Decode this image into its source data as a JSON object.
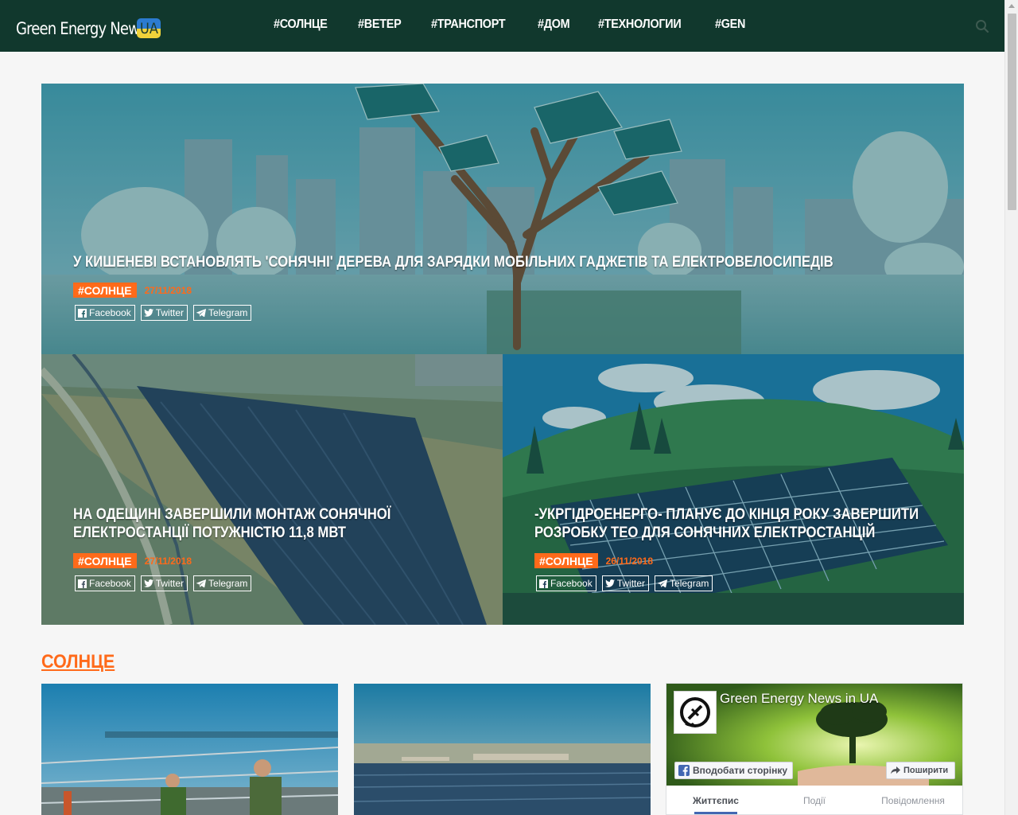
{
  "header": {
    "logo_text": "Green Energy News",
    "logo_badge": "UA",
    "nav": [
      "#СОЛНЦЕ",
      "#ВЕТЕР",
      "#ТРАНСПОРТ",
      "#ДОМ",
      "#ТЕХНОЛОГИИ",
      "#GEN"
    ]
  },
  "featured": [
    {
      "title_lines": [
        "У КИШЕНЕВІ ВСТАНОВЛЯТЬ 'СОНЯЧНІ' ДЕРЕВА ДЛЯ ЗАРЯДКИ МОБІЛЬНИХ ГАДЖЕТІВ ТА ЕЛЕКТРОВЕЛОСИПЕДІВ"
      ],
      "category": "#СОЛНЦЕ",
      "date": "27/11/2018"
    },
    {
      "title_lines": [
        "НА ОДЕЩИНІ ЗАВЕРШИЛИ МОНТАЖ СОНЯЧНОЇ",
        "ЕЛЕКТРОСТАНЦІЇ ПОТУЖНІСТЮ 11,8 МВТ"
      ],
      "category": "#СОЛНЦЕ",
      "date": "27/11/2018"
    },
    {
      "title_lines": [
        "-УКРГІДРОЕНЕРГО- ПЛАНУЄ ДО КІНЦЯ РОКУ ЗАВЕРШИТИ",
        "РОЗРОБКУ ТЕО ДЛЯ СОНЯЧНИХ ЕЛЕКТРОСТАНЦІЙ"
      ],
      "category": "#СОЛНЦЕ",
      "date": "26/11/2018"
    }
  ],
  "share_labels": [
    "Facebook",
    "Twitter",
    "Telegram"
  ],
  "section": {
    "title": "СОЛНЦЕ"
  },
  "fb_widget": {
    "page_name": "Green Energy News in UA",
    "like_label": "Вподобати сторінку",
    "share_label": "Поширити",
    "tabs": [
      "Життєпис",
      "Події",
      "Повідомлення"
    ]
  },
  "colors": {
    "header_bg": "#11382d",
    "accent": "#ff6a1a",
    "page_bg": "#f6f6f6"
  },
  "icons": [
    "search-icon",
    "facebook-icon",
    "twitter-icon",
    "telegram-icon",
    "share-arrow-icon"
  ]
}
